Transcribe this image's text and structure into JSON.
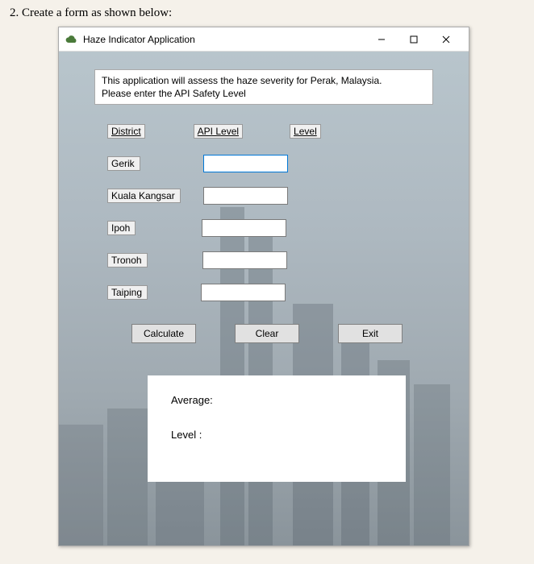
{
  "instruction": "2. Create a form as shown below:",
  "window": {
    "title": "Haze Indicator Application"
  },
  "intro": {
    "line1": "This application will assess the haze severity for Perak, Malaysia.",
    "line2": "Please enter the  API Safety Level"
  },
  "headers": {
    "district": "District",
    "api": "API Level",
    "level": "Level"
  },
  "districts": {
    "d0": "Gerik",
    "d1": "Kuala Kangsar",
    "d2": "Ipoh",
    "d3": "Tronoh",
    "d4": "Taiping"
  },
  "inputs": {
    "v0": "",
    "v1": "",
    "v2": "",
    "v3": "",
    "v4": ""
  },
  "buttons": {
    "calculate": "Calculate",
    "clear": "Clear",
    "exit": "Exit"
  },
  "output": {
    "average_label": "Average:",
    "level_label": "Level :",
    "average_value": "",
    "level_value": ""
  }
}
